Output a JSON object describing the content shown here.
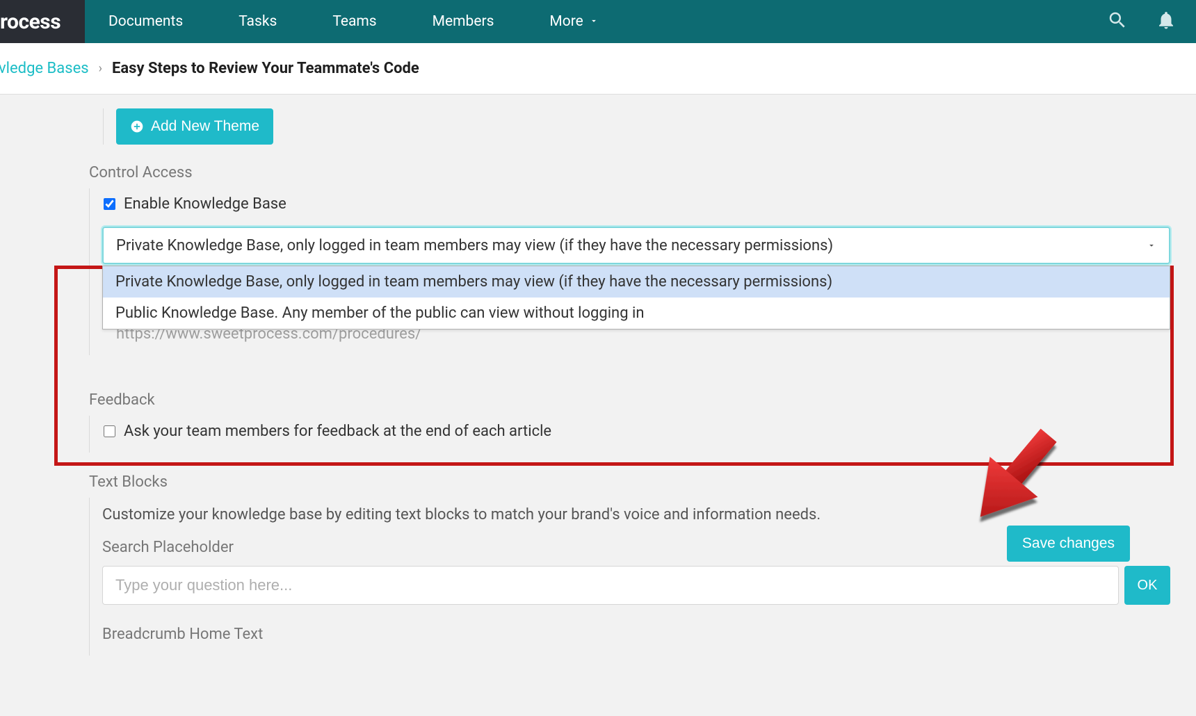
{
  "brand": "rocess",
  "nav": {
    "items": [
      "Documents",
      "Tasks",
      "Teams",
      "Members",
      "More"
    ]
  },
  "breadcrumb": {
    "link": "vledge Bases",
    "sep": "›",
    "current": "Easy Steps to Review Your Teammate's Code"
  },
  "add_theme": "Add New Theme",
  "control_access": {
    "title": "Control Access",
    "enable_label": "Enable Knowledge Base",
    "enable_checked": true,
    "selected_value": "Private Knowledge Base, only logged in team members may view (if they have the necessary permissions)",
    "options": [
      "Private Knowledge Base, only logged in team members may view (if they have the necessary permissions)",
      "Public Knowledge Base. Any member of the public can view without logging in"
    ],
    "url": "https://www.sweetprocess.com/procedures/"
  },
  "feedback": {
    "title": "Feedback",
    "label": "Ask your team members for feedback at the end of each article",
    "checked": false
  },
  "save_label": "Save changes",
  "text_blocks": {
    "title": "Text Blocks",
    "desc": "Customize your knowledge base by editing text blocks to match your brand's voice and information needs.",
    "search_label": "Search Placeholder",
    "search_placeholder": "Type your question here...",
    "ok": "OK",
    "breadcrumb_label": "Breadcrumb Home Text"
  }
}
